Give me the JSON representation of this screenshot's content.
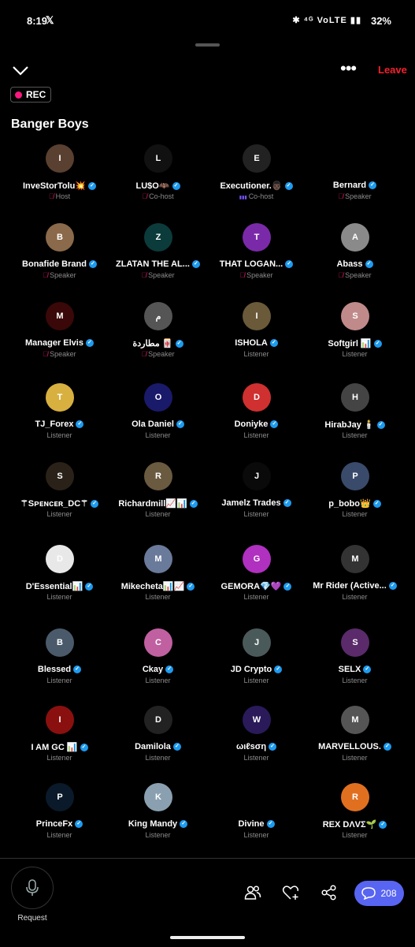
{
  "status": {
    "time": "8:19",
    "app_icon": "x-logo",
    "icons": "✱ ⁴ᴳ VoLTE ▮▮",
    "battery": "32%"
  },
  "header": {
    "leave_label": "Leave",
    "rec_label": "REC",
    "space_title": "Banger Boys"
  },
  "participants": [
    {
      "name": "InveStorTolu💥",
      "role": "Host",
      "muted": true,
      "color": "#5a4030",
      "initial": "I"
    },
    {
      "name": "LU$O🦇",
      "role": "Co-host",
      "muted": true,
      "color": "#111",
      "initial": "L"
    },
    {
      "name": "Executioner.👨🏿",
      "role": "Co-host",
      "muted": false,
      "speaking": true,
      "color": "#222",
      "initial": "E"
    },
    {
      "name": "Bernard",
      "role": "Speaker",
      "muted": true,
      "color": "#000",
      "initial": ""
    },
    {
      "name": "Bonafide Brand",
      "role": "Speaker",
      "muted": true,
      "color": "#8a6a4a",
      "initial": "B"
    },
    {
      "name": "ZLATAN THE AL...",
      "role": "Speaker",
      "muted": true,
      "color": "#0c3b3b",
      "initial": "Z"
    },
    {
      "name": "THAT LOGAN...",
      "role": "Speaker",
      "muted": true,
      "color": "#7a2aa8",
      "initial": "T"
    },
    {
      "name": "Abass",
      "role": "Speaker",
      "muted": true,
      "color": "#8a8a8a",
      "initial": "A"
    },
    {
      "name": "Manager Elvis",
      "role": "Speaker",
      "muted": true,
      "color": "#3a0808",
      "initial": "M"
    },
    {
      "name": "مطاردة 🀄",
      "role": "Speaker",
      "muted": true,
      "color": "#555",
      "initial": "م"
    },
    {
      "name": "ISHOLA",
      "role": "Listener",
      "muted": false,
      "color": "#6a5a3a",
      "initial": "I"
    },
    {
      "name": "Softgirl 📊",
      "role": "Listener",
      "muted": false,
      "color": "#c08a8a",
      "initial": "S"
    },
    {
      "name": "TJ_Forex",
      "role": "Listener",
      "muted": false,
      "color": "#d8b040",
      "initial": "T"
    },
    {
      "name": "Ola Daniel",
      "role": "Listener",
      "muted": false,
      "color": "#1a1a6a",
      "initial": "O"
    },
    {
      "name": "Doniyke",
      "role": "Listener",
      "muted": false,
      "color": "#d03030",
      "initial": "D"
    },
    {
      "name": "HirabJay 🕯️",
      "role": "Listener",
      "muted": false,
      "color": "#444",
      "initial": "H"
    },
    {
      "name": "⚚Sᴘᴇɴᴄᴇʀ_DC⚚",
      "role": "Listener",
      "muted": false,
      "color": "#2a2218",
      "initial": "S"
    },
    {
      "name": "Richardmill📈📊",
      "role": "Listener",
      "muted": false,
      "color": "#6a5a40",
      "initial": "R"
    },
    {
      "name": "Jamelz Trades",
      "role": "Listener",
      "muted": false,
      "color": "#0a0a0a",
      "initial": "J"
    },
    {
      "name": "p_bobo👑",
      "role": "Listener",
      "muted": false,
      "color": "#3a4a6a",
      "initial": "P"
    },
    {
      "name": "D'Essential📊",
      "role": "Listener",
      "muted": false,
      "color": "#e8e8e8",
      "initial": "D"
    },
    {
      "name": "Mikecheta📊📈",
      "role": "Listener",
      "muted": false,
      "color": "#6a7a9a",
      "initial": "M"
    },
    {
      "name": "GEMORA💎💜",
      "role": "Listener",
      "muted": false,
      "color": "#b030c0",
      "initial": "G"
    },
    {
      "name": "Mr Rider (Active...",
      "role": "Listener",
      "muted": false,
      "color": "#333",
      "initial": "M"
    },
    {
      "name": "Blessed",
      "role": "Listener",
      "muted": false,
      "color": "#4a5a6a",
      "initial": "B"
    },
    {
      "name": "Ckay",
      "role": "Listener",
      "muted": false,
      "color": "#c060a0",
      "initial": "C"
    },
    {
      "name": "JD Crypto",
      "role": "Listener",
      "muted": false,
      "color": "#4a5a5a",
      "initial": "J"
    },
    {
      "name": "SELX",
      "role": "Listener",
      "muted": false,
      "color": "#5a2a6a",
      "initial": "S"
    },
    {
      "name": "I AM GC 📊",
      "role": "Listener",
      "muted": false,
      "color": "#8a1010",
      "initial": "I"
    },
    {
      "name": "Damilola",
      "role": "Listener",
      "muted": false,
      "color": "#222",
      "initial": "D"
    },
    {
      "name": "ωιℓsση",
      "role": "Listener",
      "muted": false,
      "color": "#2a1a5a",
      "initial": "W"
    },
    {
      "name": "MARVELLOUS.",
      "role": "Listener",
      "muted": false,
      "color": "#555",
      "initial": "M"
    },
    {
      "name": "PrinceFx",
      "role": "Listener",
      "muted": false,
      "color": "#0a1a2a",
      "initial": "P"
    },
    {
      "name": "King Mandy",
      "role": "Listener",
      "muted": false,
      "color": "#8aa0b0",
      "initial": "K"
    },
    {
      "name": "Divine",
      "role": "Listener",
      "muted": false,
      "color": "#000",
      "initial": ""
    },
    {
      "name": "REX DΛVΣ🌱",
      "role": "Listener",
      "muted": false,
      "color": "#e07020",
      "initial": "R"
    }
  ],
  "bottom": {
    "request_label": "Request",
    "comment_count": "208"
  },
  "colors": {
    "accent": "#1d9bf0",
    "leave": "#f4212e",
    "chat_button": "#5865f2",
    "rec_dot": "#f91880"
  }
}
